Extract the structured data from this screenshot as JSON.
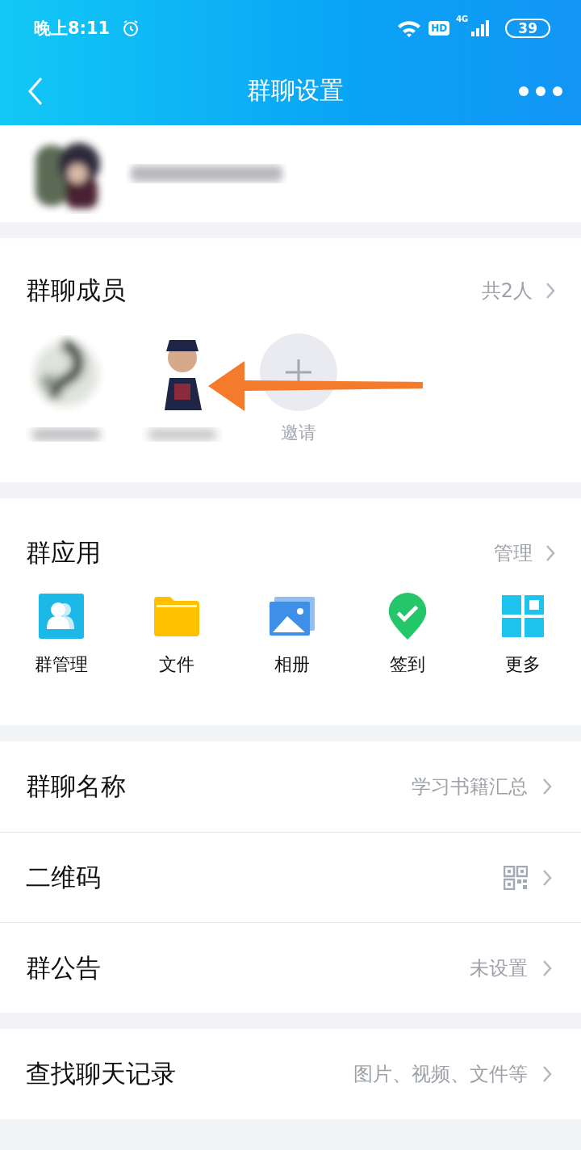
{
  "status_bar": {
    "time": "晚上8:11",
    "hd": "HD",
    "network": "4G",
    "battery": "39"
  },
  "nav": {
    "title": "群聊设置"
  },
  "group": {
    "kind": "blurred"
  },
  "members": {
    "title": "群聊成员",
    "count": "共2人",
    "items": [
      {
        "kind": "blurred"
      },
      {
        "kind": "avatar"
      },
      {
        "kind": "invite",
        "label": "邀请"
      }
    ]
  },
  "apps": {
    "title": "群应用",
    "action": "管理",
    "items": [
      {
        "kind": "people",
        "label": "群管理"
      },
      {
        "kind": "folder",
        "label": "文件"
      },
      {
        "kind": "album",
        "label": "相册"
      },
      {
        "kind": "checkin",
        "label": "签到"
      },
      {
        "kind": "grid",
        "label": "更多"
      }
    ]
  },
  "rows": [
    {
      "kind": "text",
      "label": "群聊名称",
      "value": "学习书籍汇总"
    },
    {
      "kind": "qr",
      "label": "二维码"
    },
    {
      "kind": "text",
      "label": "群公告",
      "value": "未设置"
    },
    {
      "kind": "text",
      "label": "查找聊天记录",
      "value": "图片、视频、文件等"
    }
  ]
}
